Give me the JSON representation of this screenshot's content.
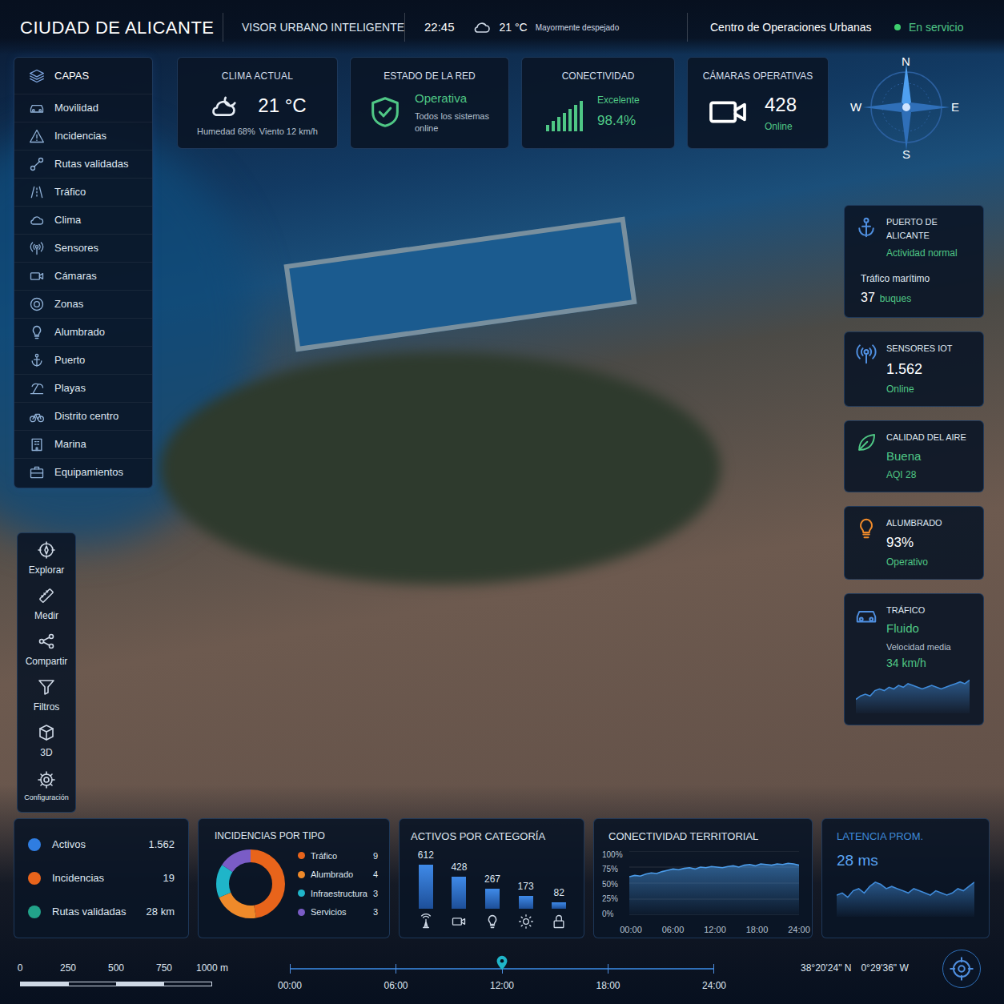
{
  "header": {
    "title": "CIUDAD DE ALICANTE",
    "subtitle": "VISOR URBANO INTELIGENTE",
    "time": "22:45",
    "temperature": "21 °C",
    "weather": "Mayormente despejado",
    "center": "Centro de Operaciones Urbanas",
    "status": "En servicio",
    "online": true
  },
  "layers": {
    "title": "CAPAS",
    "items": [
      {
        "label": "Movilidad",
        "active": false
      },
      {
        "label": "Incidencias",
        "active": false
      },
      {
        "label": "Rutas validadas",
        "active": true
      },
      {
        "label": "Tráfico",
        "active": false
      },
      {
        "label": "Clima",
        "active": false
      },
      {
        "label": "Sensores",
        "active": false
      },
      {
        "label": "Cámaras",
        "active": false
      },
      {
        "label": "Zonas",
        "active": false
      },
      {
        "label": "Alumbrado",
        "active": false
      },
      {
        "label": "Puerto",
        "active": false
      },
      {
        "label": "Playas",
        "active": false
      },
      {
        "label": "Distrito centro",
        "active": false
      },
      {
        "label": "Marina",
        "active": false
      },
      {
        "label": "Equipamientos",
        "active": false
      }
    ]
  },
  "tools": [
    {
      "label": "Explorar"
    },
    {
      "label": "Medir"
    },
    {
      "label": "Compartir"
    },
    {
      "label": "Filtros"
    },
    {
      "label": "3D"
    },
    {
      "label": "Configuración"
    }
  ],
  "weather_card": {
    "title": "CLIMA ACTUAL",
    "temperature": "21 °C",
    "humidity": "Humedad 68%",
    "wind": "Viento 12 km/h"
  },
  "network_card": {
    "title": "ESTADO DE LA RED",
    "status": "Operativa",
    "detail": "Todos los sistemas online"
  },
  "connectivity_card": {
    "title": "CONECTIVIDAD",
    "status": "Excelente",
    "value": "98.4%",
    "level": 0.984
  },
  "cameras_card": {
    "title": "CÁMARAS OPERATIVAS",
    "value": "428",
    "status": "Online"
  },
  "compass": {
    "north": "N",
    "south": "S",
    "east": "E",
    "west": "W"
  },
  "port_card": {
    "title": "PUERTO DE ALICANTE",
    "status": "Actividad normal",
    "label": "Tráfico marítimo",
    "value": "37",
    "unit": "buques"
  },
  "sensors_card": {
    "title": "SENSORES IOT",
    "value": "1.562",
    "status": "Online"
  },
  "air_card": {
    "title": "CALIDAD DEL AIRE",
    "value": "Buena",
    "detail": "AQI 28"
  },
  "lighting_card": {
    "title": "ALUMBRADO",
    "value": "93%",
    "status": "Operativo"
  },
  "traffic_card": {
    "title": "TRÁFICO",
    "value": "Fluido",
    "label": "Velocidad media",
    "speed": "34 km/h",
    "series": [
      28,
      30,
      31,
      30,
      33,
      34,
      33,
      35,
      34,
      36,
      35,
      37,
      36,
      35,
      34,
      35,
      36,
      35,
      34,
      35,
      36,
      37,
      38,
      37,
      39
    ]
  },
  "summary": [
    {
      "label": "Activos",
      "value": "1.562",
      "color": "#2f7de1"
    },
    {
      "label": "Incidencias",
      "value": "19",
      "color": "#e8641b"
    },
    {
      "label": "Rutas validadas",
      "value": "28 km",
      "color": "#22a38a"
    }
  ],
  "incidents": {
    "title": "INCIDENCIAS POR TIPO",
    "items": [
      {
        "label": "Tráfico",
        "value": "9",
        "color": "#e8641b"
      },
      {
        "label": "Alumbrado",
        "value": "4",
        "color": "#ef8a2a"
      },
      {
        "label": "Infraestructura",
        "value": "3",
        "color": "#1fb5c9"
      },
      {
        "label": "Servicios",
        "value": "3",
        "color": "#7a5cc6"
      }
    ]
  },
  "assets": {
    "title": "ACTIVOS POR CATEGORÍA",
    "bars": [
      {
        "value": "612"
      },
      {
        "value": "428"
      },
      {
        "value": "267"
      },
      {
        "value": "173"
      },
      {
        "value": "82"
      }
    ]
  },
  "connectivity_chart": {
    "title": "CONECTIVIDAD TERRITORIAL",
    "y_ticks": [
      "100%",
      "75%",
      "50%",
      "25%",
      "0%"
    ],
    "x_ticks": [
      "00:00",
      "06:00",
      "12:00",
      "18:00",
      "24:00"
    ],
    "series": [
      60,
      62,
      61,
      64,
      66,
      65,
      68,
      70,
      72,
      71,
      73,
      74,
      72,
      75,
      74,
      76,
      75,
      74,
      76,
      77,
      75,
      78,
      79,
      77,
      80,
      79,
      78,
      80,
      79,
      81,
      80,
      78
    ]
  },
  "latency": {
    "title": "LATENCIA PROM.",
    "value": "28 ms",
    "series": [
      30,
      31,
      29,
      32,
      33,
      31,
      34,
      36,
      35,
      33,
      34,
      33,
      32,
      31,
      33,
      32,
      31,
      30,
      32,
      31,
      30,
      31,
      33,
      32,
      34,
      36
    ]
  },
  "scale": {
    "ticks": [
      "0",
      "250",
      "500",
      "750",
      "1000 m"
    ]
  },
  "timeline": {
    "ticks": [
      "00:00",
      "06:00",
      "12:00",
      "18:00",
      "24:00"
    ],
    "level": 0.5
  },
  "coordinates": {
    "latitude": "38°20'24\" N",
    "longitude": "0°29'36\" W"
  }
}
